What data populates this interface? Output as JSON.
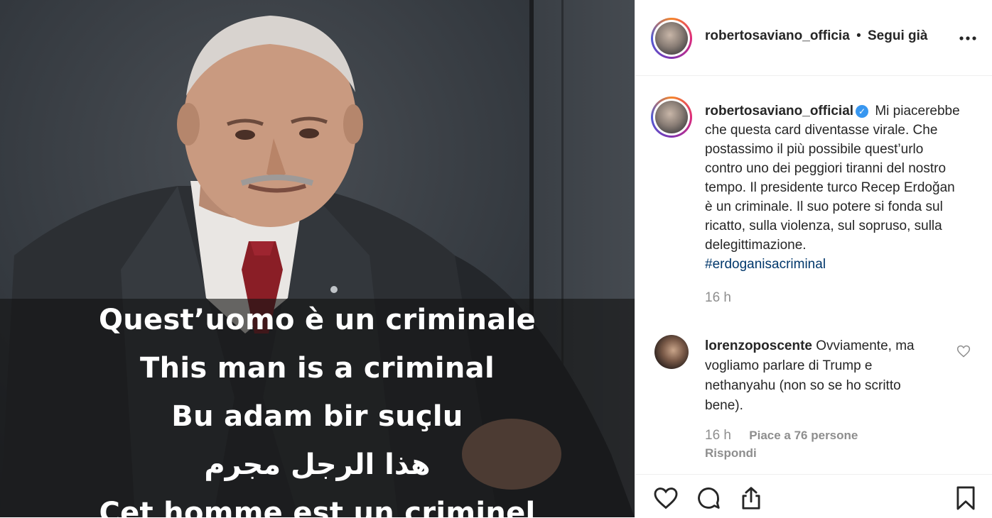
{
  "post_image": {
    "captions": [
      "Quest’uomo è un criminale",
      "This man is a criminal",
      "Bu adam bir suçlu",
      "هذا الرجل مجرم",
      "Cet homme est un criminel"
    ]
  },
  "header": {
    "username": "robertosaviano_officia",
    "separator": "•",
    "follow_status": "Segui già",
    "more_icon": "more-horizontal-icon"
  },
  "caption": {
    "username": "robertosaviano_official",
    "verified_icon": "verified-badge-icon",
    "text": "Mi piacerebbe che questa card diventasse virale. Che postassimo il più possibile quest’urlo contro uno dei peggiori tiranni del nostro tempo. Il presidente turco Recep Erdoğan è un criminale. Il suo potere si fonda sul ricatto, sulla violenza, sul sopruso, sulla delegittimazione.",
    "hashtag": "#erdoganisacriminal",
    "time": "16 h"
  },
  "comment": {
    "username": "lorenzoposcente",
    "text": "Ovviamente, ma vogliamo parlare di Trump e nethanyahu (non so se ho scritto bene).",
    "time": "16 h",
    "likes": "Piace a 76 persone",
    "reply": "Rispondi"
  },
  "actions": [
    "heart-icon",
    "comment-icon",
    "share-icon",
    "bookmark-icon"
  ],
  "colors": {
    "link": "#00376b",
    "muted": "#8e8e8e",
    "verified": "#3897f0",
    "text": "#262626"
  }
}
